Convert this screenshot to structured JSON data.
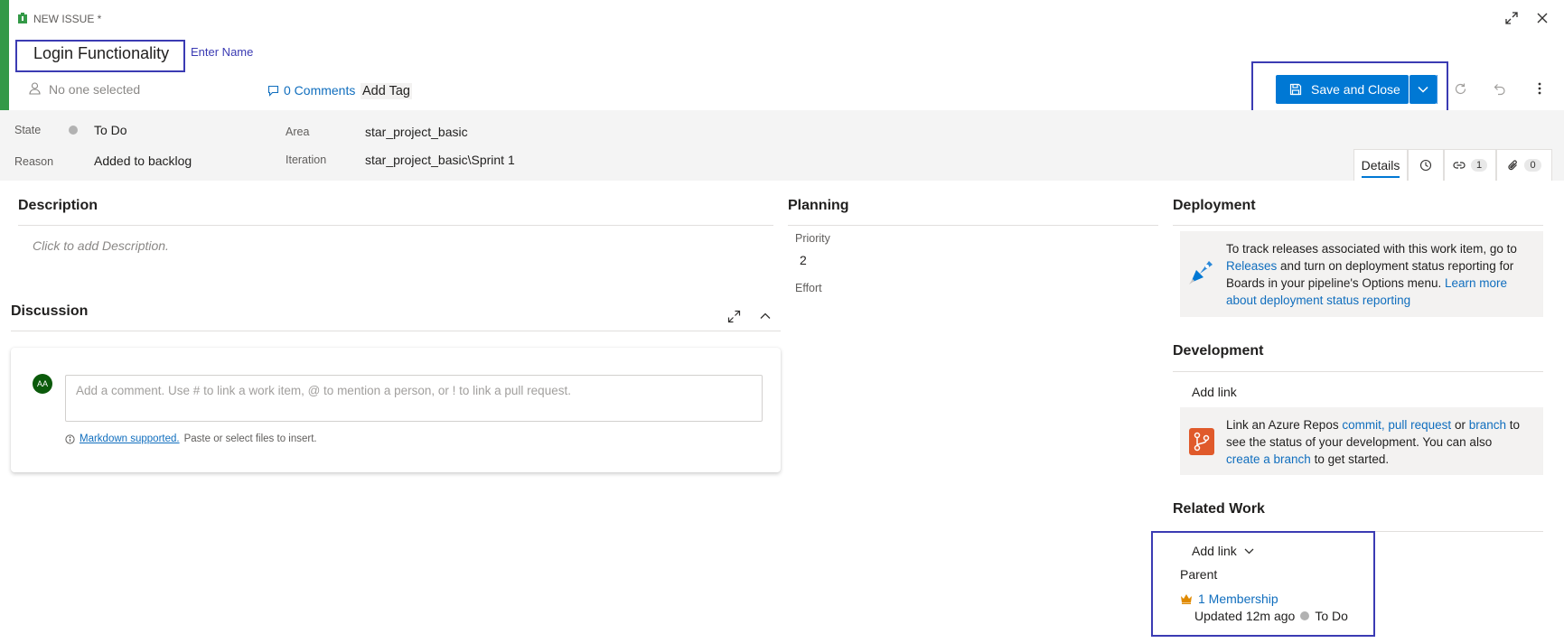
{
  "header": {
    "type_label": "NEW ISSUE *",
    "title_value": "Login Functionality",
    "title_hint": "Enter Name",
    "assignee_placeholder": "No one selected",
    "comments_label": "0 Comments",
    "add_tag_label": "Add Tag",
    "save_label": "Save and Close"
  },
  "fields": {
    "state_label": "State",
    "state_value": "To Do",
    "reason_label": "Reason",
    "reason_value": "Added to backlog",
    "area_label": "Area",
    "area_value": "star_project_basic",
    "iteration_label": "Iteration",
    "iteration_value": "star_project_basic\\Sprint 1"
  },
  "tabs": {
    "details_label": "Details",
    "links_count": "1",
    "attachments_count": "0"
  },
  "description": {
    "title": "Description",
    "placeholder": "Click to add Description."
  },
  "discussion": {
    "title": "Discussion",
    "avatar_initials": "AA",
    "comment_placeholder": "Add a comment. Use # to link a work item, @ to mention a person, or ! to link a pull request.",
    "markdown_link": "Markdown supported.",
    "markdown_note": "Paste or select files to insert."
  },
  "planning": {
    "title": "Planning",
    "priority_label": "Priority",
    "priority_value": "2",
    "effort_label": "Effort"
  },
  "deployment": {
    "title": "Deployment",
    "text_1": "To track releases associated with this work item, go to",
    "link_releases": "Releases",
    "text_2": "and turn on deployment status reporting for",
    "text_3": "Boards in your pipeline's Options menu.",
    "link_learn_1": "Learn more",
    "link_learn_2": "about deployment status reporting"
  },
  "development": {
    "title": "Development",
    "add_link_label": "Add link",
    "text_1": "Link an Azure Repos",
    "link_commit": "commit,",
    "link_pull_request": "pull request",
    "text_or": "or",
    "link_branch": "branch",
    "text_to": "to",
    "text_2": "see the status of your development. You can also",
    "link_create_branch": "create a branch",
    "text_3": "to get started."
  },
  "related_work": {
    "title": "Related Work",
    "add_link_label": "Add link",
    "group_label": "Parent",
    "item_link": "1 Membership",
    "item_updated": "Updated 12m ago",
    "item_state": "To Do"
  },
  "colors": {
    "accent_green": "#339947",
    "primary_blue": "#0078d4",
    "highlight_box": "#3b3bb3",
    "link_blue": "#106ebe"
  }
}
